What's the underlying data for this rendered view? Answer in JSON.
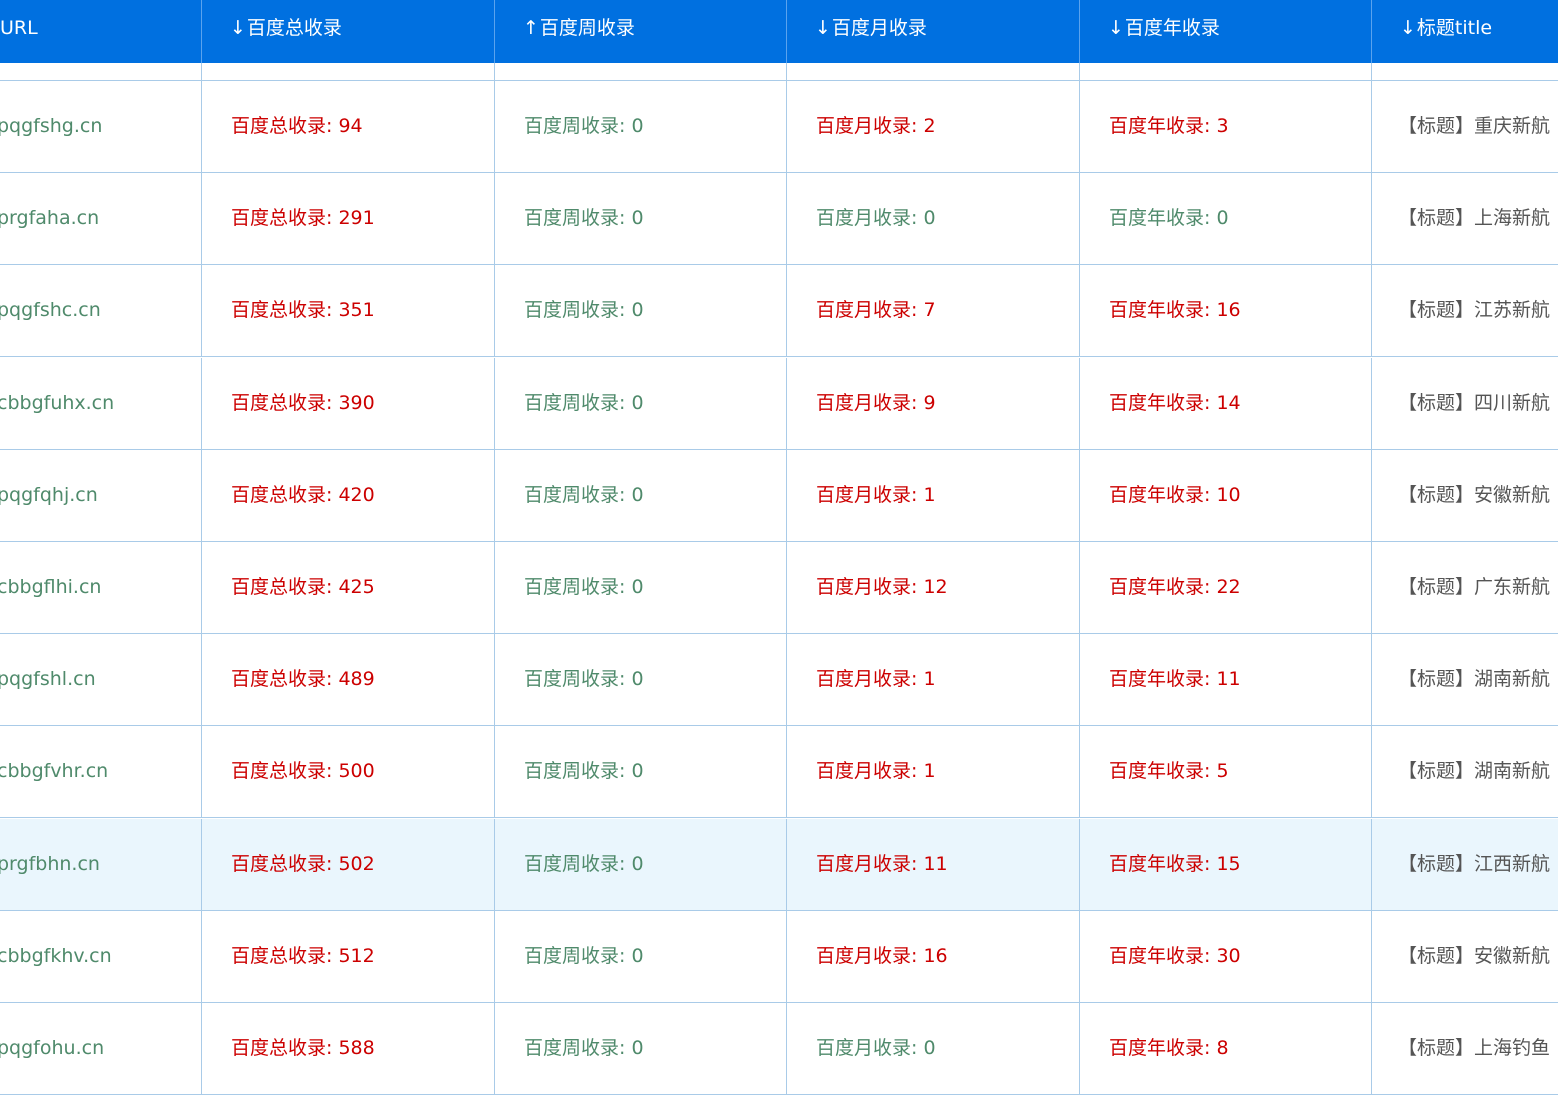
{
  "header": {
    "url": "URL",
    "total": {
      "arrow": "↓",
      "label": "百度总收录"
    },
    "week": {
      "arrow": "↑",
      "label": "百度周收录"
    },
    "month": {
      "arrow": "↓",
      "label": "百度月收录"
    },
    "year": {
      "arrow": "↓",
      "label": "百度年收录"
    },
    "title": {
      "arrow": "↓",
      "label": "标题title"
    }
  },
  "colors": {
    "header_bg": "#0070e0",
    "highlight_value": "#cc0000",
    "zero_value": "#4f8a6b",
    "row_hover": "#eaf6fd"
  },
  "rows": [
    {
      "url": "pqgfshg.cn",
      "total": "百度总收录: 94",
      "week": "百度周收录: 0",
      "month": "百度月收录: 2",
      "month_zero": false,
      "year": "百度年收录: 3",
      "year_zero": false,
      "title": "【标题】重庆新航"
    },
    {
      "url": "prgfaha.cn",
      "total": "百度总收录: 291",
      "week": "百度周收录: 0",
      "month": "百度月收录: 0",
      "month_zero": true,
      "year": "百度年收录: 0",
      "year_zero": true,
      "title": "【标题】上海新航"
    },
    {
      "url": "pqgfshc.cn",
      "total": "百度总收录: 351",
      "week": "百度周收录: 0",
      "month": "百度月收录: 7",
      "month_zero": false,
      "year": "百度年收录: 16",
      "year_zero": false,
      "title": "【标题】江苏新航"
    },
    {
      "url": "cbbgfuhx.cn",
      "total": "百度总收录: 390",
      "week": "百度周收录: 0",
      "month": "百度月收录: 9",
      "month_zero": false,
      "year": "百度年收录: 14",
      "year_zero": false,
      "title": "【标题】四川新航"
    },
    {
      "url": "pqgfqhj.cn",
      "total": "百度总收录: 420",
      "week": "百度周收录: 0",
      "month": "百度月收录: 1",
      "month_zero": false,
      "year": "百度年收录: 10",
      "year_zero": false,
      "title": "【标题】安徽新航"
    },
    {
      "url": "cbbgflhi.cn",
      "total": "百度总收录: 425",
      "week": "百度周收录: 0",
      "month": "百度月收录: 12",
      "month_zero": false,
      "year": "百度年收录: 22",
      "year_zero": false,
      "title": "【标题】广东新航"
    },
    {
      "url": "pqgfshl.cn",
      "total": "百度总收录: 489",
      "week": "百度周收录: 0",
      "month": "百度月收录: 1",
      "month_zero": false,
      "year": "百度年收录: 11",
      "year_zero": false,
      "title": "【标题】湖南新航"
    },
    {
      "url": "cbbgfvhr.cn",
      "total": "百度总收录: 500",
      "week": "百度周收录: 0",
      "month": "百度月收录: 1",
      "month_zero": false,
      "year": "百度年收录: 5",
      "year_zero": false,
      "title": "【标题】湖南新航"
    },
    {
      "url": "prgfbhn.cn",
      "total": "百度总收录: 502",
      "week": "百度周收录: 0",
      "month": "百度月收录: 11",
      "month_zero": false,
      "year": "百度年收录: 15",
      "year_zero": false,
      "title": "【标题】江西新航",
      "highlighted": true
    },
    {
      "url": "cbbgfkhv.cn",
      "total": "百度总收录: 512",
      "week": "百度周收录: 0",
      "month": "百度月收录: 16",
      "month_zero": false,
      "year": "百度年收录: 30",
      "year_zero": false,
      "title": "【标题】安徽新航"
    },
    {
      "url": "pqgfohu.cn",
      "total": "百度总收录: 588",
      "week": "百度周收录: 0",
      "month": "百度月收录: 0",
      "month_zero": true,
      "year": "百度年收录: 8",
      "year_zero": false,
      "title": "【标题】上海钓鱼"
    }
  ]
}
